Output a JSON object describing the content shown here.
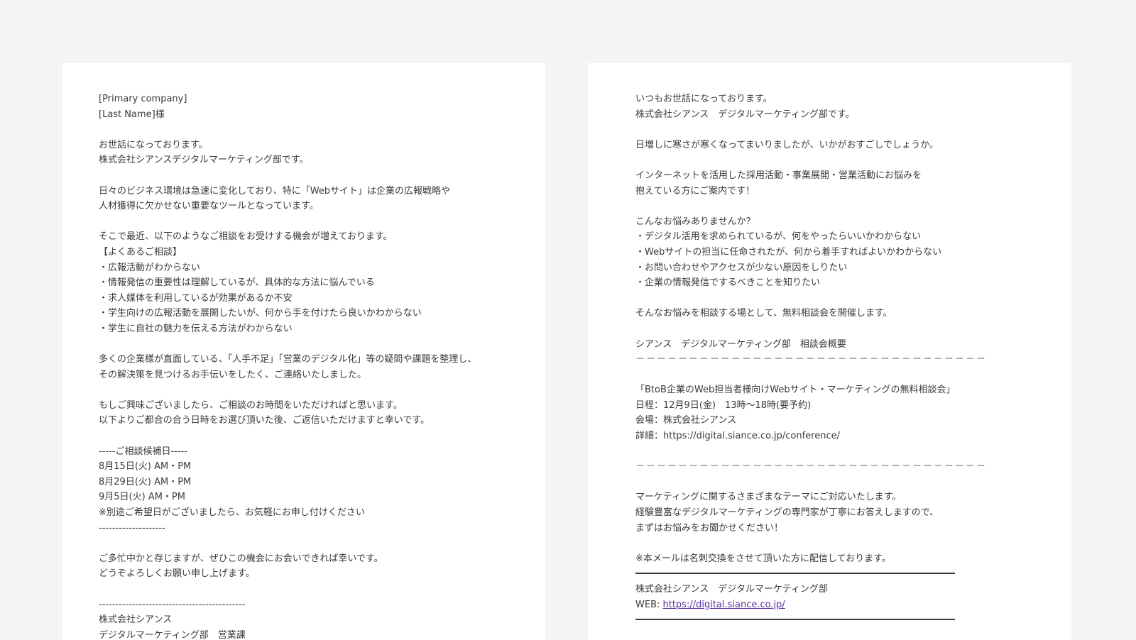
{
  "left_email": {
    "lines": [
      "[Primary company]",
      "[Last Name]様",
      "",
      "お世話になっております。",
      "株式会社シアンスデジタルマーケティング部です。",
      "",
      "日々のビジネス環境は急速に変化しており、特に「Webサイト」は企業の広報戦略や",
      "人材獲得に欠かせない重要なツールとなっています。",
      "",
      "そこで最近、以下のようなご相談をお受けする機会が増えております。",
      "【よくあるご相談】",
      "・広報活動がわからない",
      "・情報発信の重要性は理解しているが、具体的な方法に悩んでいる",
      "・求人媒体を利用しているが効果があるか不安",
      "・学生向けの広報活動を展開したいが、何から手を付けたら良いかわからない",
      "・学生に自社の魅力を伝える方法がわからない",
      "",
      "多くの企業様が直面している、「人手不足」「営業のデジタル化」等の疑問や課題を整理し、",
      "その解決策を見つけるお手伝いをしたく、ご連絡いたしました。",
      "",
      "もしご興味ございましたら、ご相談のお時間をいただければと思います。",
      "以下よりご都合の合う日時をお選び頂いた後、ご返信いただけますと幸いです。",
      "",
      "-----ご相談候補日-----",
      "8月15日(火) AM・PM",
      "8月29日(火) AM・PM",
      "9月5日(火) AM・PM",
      "※別途ご希望日がございましたら、お気軽にお申し付けください",
      "--------------------",
      "",
      "ご多忙中かと存じますが、ぜひこの機会にお会いできれば幸いです。",
      "どうぞよろしくお願い申し上げます。",
      "",
      "--------------------------------------------",
      "株式会社シアンス",
      "デジタルマーケティング部　営業課"
    ]
  },
  "right_email": {
    "greeting": [
      "いつもお世話になっております。",
      "株式会社シアンス　デジタルマーケティング部です。",
      "",
      "日増しに寒さが寒くなってまいりましたが、いかがおすごしでしょうか。",
      "",
      "インターネットを活用した採用活動・事業展開・営業活動にお悩みを",
      "抱えている方にご案内です！",
      "",
      "こんなお悩みありませんか？",
      "・デジタル活用を求められているが、何をやったらいいかわからない",
      "・Webサイトの担当に任命されたが、何から着手すればよいかわからない",
      "・お問い合わせやアクセスが少ない原因をしりたい",
      "・企業の情報発信でするべきことを知りたい",
      "",
      "そんなお悩みを相談する場として、無料相談会を開催します。",
      "",
      "シアンス　デジタルマーケティング部　相談会概要"
    ],
    "dash_line": "－－－－－－－－－－－－－－－－－－－－－－－－－－－－－－－－－",
    "event": [
      "「BtoB企業のWeb担当者様向けWebサイト・マーケティングの無料相談会」",
      "日程：12月9日(金)　13時～18時(要予約)",
      "会場：株式会社シアンス",
      "詳細：https://digital.siance.co.jp/conference/"
    ],
    "closing": [
      "マーケティングに関するさまざまなテーマにご対応いたします。",
      "経験豊富なデジタルマーケティングの専門家が丁寧にお答えしますので、",
      "まずはお悩みをお聞かせください！",
      "",
      "※本メールは名刺交換をさせて頂いた方に配信しております。"
    ],
    "signature": {
      "company": "株式会社シアンス　デジタルマーケティング部",
      "web_prefix": "WEB: ",
      "web_url": "https://digital.siance.co.jp/"
    }
  },
  "colors": {
    "background": "#f4f4f4",
    "panel": "#ffffff",
    "text": "#3a3a3a",
    "link": "#5a2fa0"
  }
}
